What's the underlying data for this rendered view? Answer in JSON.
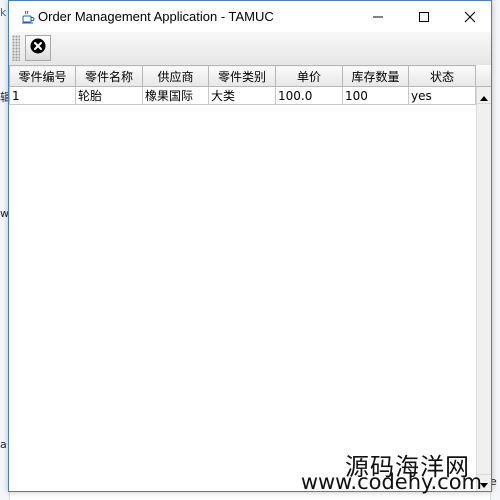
{
  "window": {
    "title": "Order Management Application - TAMUC",
    "app_icon": "java-cup-icon",
    "controls": {
      "minimize": "minimize-icon",
      "maximize": "maximize-icon",
      "close": "close-icon"
    }
  },
  "toolbar": {
    "close_button_icon": "close-circle-icon"
  },
  "table": {
    "columns": [
      "零件编号",
      "零件名称",
      "供应商",
      "零件类别",
      "单价",
      "库存数量",
      "状态"
    ],
    "rows": [
      [
        "1",
        "轮胎",
        "橡果国际",
        "大类",
        "100.0",
        "100",
        "yes"
      ]
    ]
  },
  "background_fragments": [
    "k",
    "辑",
    "w",
    "a",
    "e"
  ],
  "watermark": {
    "line1": "源码海洋网",
    "line2": "www.codehy.com"
  },
  "colors": {
    "window_border": "#4a7fb8",
    "header_bg": "#e7e7e7",
    "grid": "#c8c8c8"
  }
}
